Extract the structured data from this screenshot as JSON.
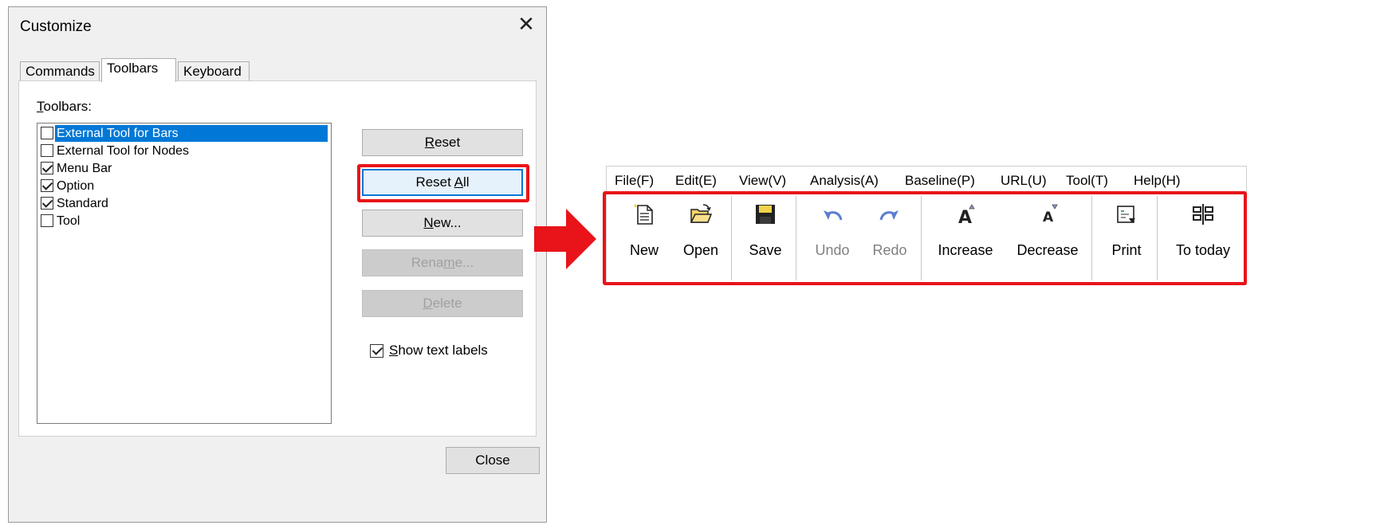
{
  "dialog": {
    "title": "Customize",
    "close_icon": "close-icon",
    "tabs": [
      {
        "label": "Commands",
        "active": false
      },
      {
        "label": "Toolbars",
        "active": true
      },
      {
        "label": "Keyboard",
        "active": false
      }
    ],
    "toolbars_label_first": "T",
    "toolbars_label_rest": "oolbars:",
    "toolbar_items": [
      {
        "label": "External Tool for Bars",
        "checked": false,
        "selected": true
      },
      {
        "label": "External Tool for Nodes",
        "checked": false,
        "selected": false
      },
      {
        "label": "Menu Bar",
        "checked": true,
        "selected": false
      },
      {
        "label": "Option",
        "checked": true,
        "selected": false
      },
      {
        "label": "Standard",
        "checked": true,
        "selected": false
      },
      {
        "label": "Tool",
        "checked": false,
        "selected": false
      }
    ],
    "buttons": {
      "reset": {
        "first": "R",
        "rest": "eset",
        "enabled": true
      },
      "reset_all": {
        "pre": "Reset ",
        "first": "A",
        "rest": "ll",
        "enabled": true,
        "highlighted": true
      },
      "new": {
        "first": "N",
        "rest": "ew...",
        "enabled": true
      },
      "rename": {
        "pre": "Rena",
        "first": "m",
        "rest": "e...",
        "enabled": false
      },
      "delete": {
        "first": "D",
        "rest": "elete",
        "enabled": false
      }
    },
    "show_text_labels": {
      "first": "S",
      "rest": "how text labels",
      "checked": true
    },
    "close_label": "Close"
  },
  "arrow_icon": "right-arrow-icon",
  "arrow_color": "#e8141a",
  "highlight_color": "#e8141a",
  "app": {
    "menu": [
      "File(F)",
      "Edit(E)",
      "View(V)",
      "Analysis(A)",
      "Baseline(P)",
      "URL(U)",
      "Tool(T)",
      "Help(H)"
    ],
    "toolbar": [
      {
        "label": "New",
        "icon": "new-document-icon",
        "enabled": true
      },
      {
        "label": "Open",
        "icon": "open-folder-icon",
        "enabled": true
      },
      {
        "label": "Save",
        "icon": "save-disk-icon",
        "enabled": true
      },
      {
        "label": "Undo",
        "icon": "undo-icon",
        "enabled": false
      },
      {
        "label": "Redo",
        "icon": "redo-icon",
        "enabled": false
      },
      {
        "label": "Increase",
        "icon": "increase-font-icon",
        "enabled": true
      },
      {
        "label": "Decrease",
        "icon": "decrease-font-icon",
        "enabled": true
      },
      {
        "label": "Print",
        "icon": "print-icon",
        "enabled": true
      },
      {
        "label": "To today",
        "icon": "to-today-icon",
        "enabled": true
      }
    ]
  }
}
